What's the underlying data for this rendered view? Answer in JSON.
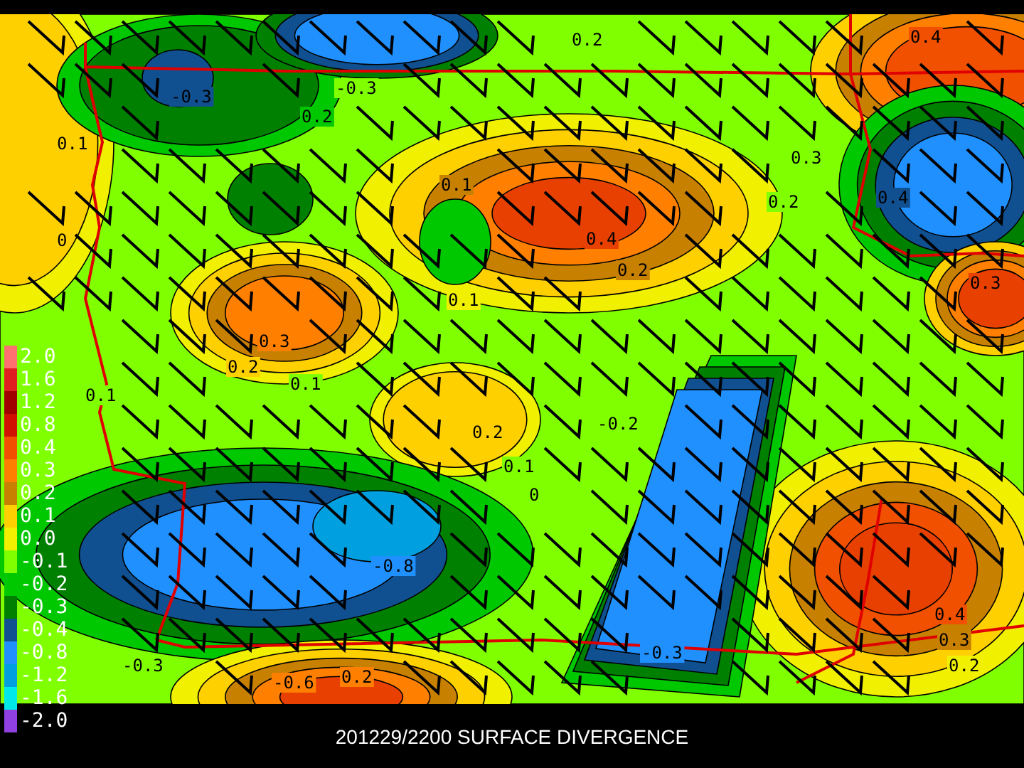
{
  "map": {
    "contour_labels": [
      "0.4",
      "0.2",
      "-0.3",
      "-0.3",
      "0.2",
      "0.1",
      "0.1",
      "0.4",
      "0.2",
      "0.3",
      "0.2",
      "0.4",
      "0.3",
      "0",
      "0.1",
      "0.3",
      "0.2",
      "0.1",
      "0.1",
      "0.2",
      "-0.2",
      "0.1",
      "0",
      "-0.8",
      "-0.3",
      "-0.3",
      "0.4",
      "0.3",
      "0.2",
      "-0.6",
      "0.2"
    ]
  },
  "legend": {
    "levels": [
      {
        "label": "2.0",
        "color": "#ff7070"
      },
      {
        "label": "1.6",
        "color": "#e02020"
      },
      {
        "label": "1.2",
        "color": "#a00000"
      },
      {
        "label": "0.8",
        "color": "#d01000"
      },
      {
        "label": "0.4",
        "color": "#f05000"
      },
      {
        "label": "0.3",
        "color": "#ff8000"
      },
      {
        "label": "0.2",
        "color": "#c88000"
      },
      {
        "label": "0.1",
        "color": "#ffd000"
      },
      {
        "label": "0.0",
        "color": "#f0f000"
      },
      {
        "label": "-0.1",
        "color": "#80ff00"
      },
      {
        "label": "-0.2",
        "color": "#00c800"
      },
      {
        "label": "-0.3",
        "color": "#008000"
      },
      {
        "label": "-0.4",
        "color": "#105090"
      },
      {
        "label": "-0.8",
        "color": "#2090ff"
      },
      {
        "label": "-1.2",
        "color": "#00a0e0"
      },
      {
        "label": "-1.6",
        "color": "#00e8e8"
      },
      {
        "label": "-2.0",
        "color": "#9040e0"
      }
    ]
  },
  "caption": "201229/2200 SURFACE DIVERGENCE"
}
